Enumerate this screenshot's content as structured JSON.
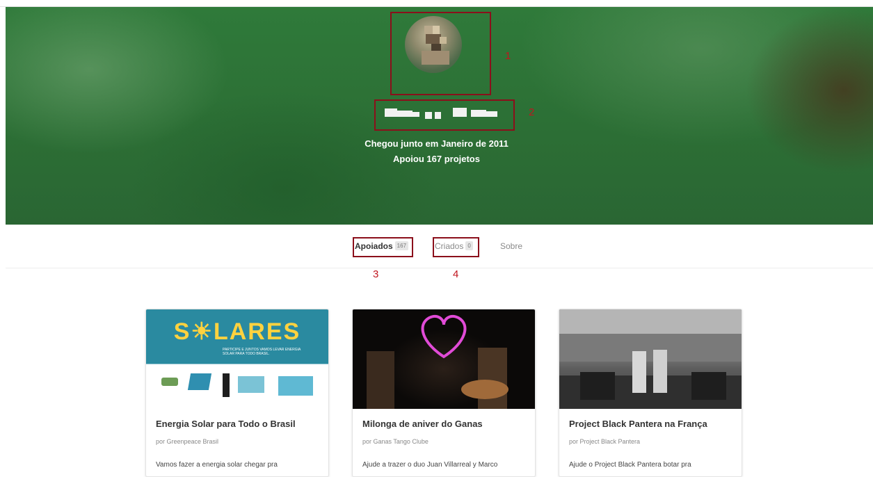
{
  "profile": {
    "joined_text": "Chegou junto em Janeiro de 2011",
    "backed_text": "Apoiou 167 projetos"
  },
  "annotations": {
    "avatar_num": "1",
    "name_num": "2",
    "tab_backed_num": "3",
    "tab_created_num": "4",
    "highlight_color": "#8b0f1b",
    "number_color": "#c0161f"
  },
  "tabs": [
    {
      "label": "Apoiados",
      "count": "167",
      "active": true
    },
    {
      "label": "Criados",
      "count": "0",
      "active": false
    },
    {
      "label": "Sobre",
      "active": false
    }
  ],
  "cards": [
    {
      "title": "Energia Solar para Todo o Brasil",
      "author": "por Greenpeace Brasil",
      "description": "Vamos fazer a energia solar chegar pra",
      "image": {
        "logo": "S☀LARES",
        "tagline": "PARTICIPE E JUNTOS VAMOS LEVAR ENERGIA SOLAR PARA TODO BRASIL."
      }
    },
    {
      "title": "Milonga de aniver do Ganas",
      "author": "por Ganas Tango Clube",
      "description": "Ajude a trazer o duo Juan Villarreal y Marco",
      "image": {
        "icon": "neon-heart-icon"
      }
    },
    {
      "title": "Project Black Pantera na França",
      "author": "por Project Black Pantera",
      "description": "Ajude o Project Black Pantera botar pra",
      "image": {
        "icon": "concert-crowd-image"
      }
    }
  ]
}
